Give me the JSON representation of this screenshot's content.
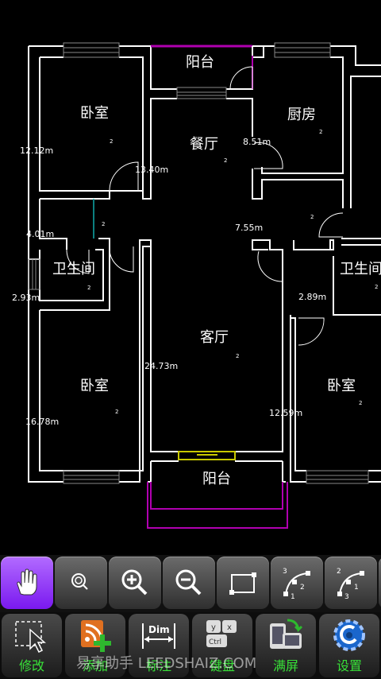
{
  "floorplan": {
    "rooms": {
      "balcony_top": "阳台",
      "bedroom_nw": "卧室",
      "kitchen": "厨房",
      "dining": "餐厅",
      "bathroom_w": "卫生间",
      "bathroom_e": "卫生间",
      "living": "客厅",
      "bedroom_sw": "卧室",
      "bedroom_se": "卧室",
      "balcony_bottom": "阳台"
    },
    "areas": {
      "a1": "12.12m",
      "a2": "13.40m",
      "a3": "8.51m",
      "a4": "4.01m",
      "a5": "7.55m",
      "a6": "2.93m",
      "a7": "2.89m",
      "a8": "24.73m",
      "a9": "16.78m",
      "a10": "12.59m"
    },
    "superscript": "2"
  },
  "toolbar_top": {
    "tools": [
      "pan-hand",
      "zoom-window",
      "zoom-in",
      "zoom-out",
      "rectangle",
      "arc-3pt-a",
      "arc-3pt-b"
    ],
    "arc_a_labels": [
      "3",
      "2",
      "1"
    ],
    "arc_b_labels": [
      "2",
      "1",
      "3"
    ]
  },
  "toolbar_bottom": {
    "modify": "修改",
    "add": "添加",
    "dimension": "标注",
    "dimension_icon_text": "Dim",
    "keyboard": "键盘",
    "keyboard_keys": [
      "y",
      "x",
      "Ctrl"
    ],
    "fullscreen": "满屏",
    "settings": "设置"
  },
  "watermark": "易享助手 LEEDSHAIZ.COM",
  "colors": {
    "wall": "#ffffff",
    "balcony": "#b000b0",
    "active_tool": "#9c3df5",
    "label_green": "#38e038",
    "window_yellow": "#c8c800"
  }
}
